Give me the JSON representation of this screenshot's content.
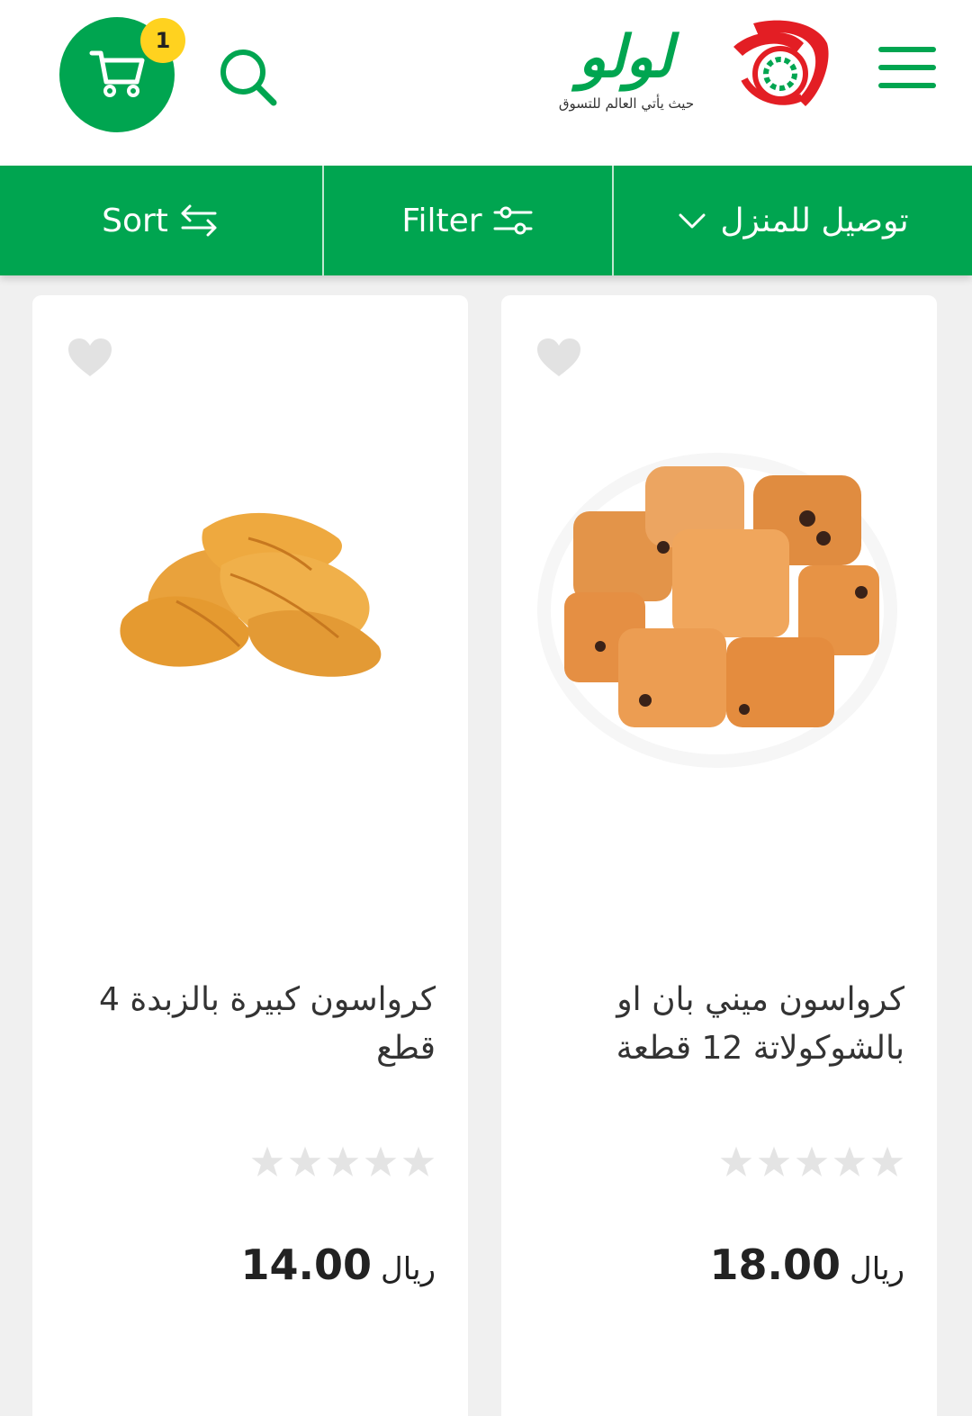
{
  "header": {
    "logo_text": "لولو",
    "logo_tagline": "حيث يأتي العالم للتسوق",
    "cart_count": "1",
    "brand_color": "#00a550",
    "badge_color": "#ffd21f",
    "icons": {
      "menu": "hamburger-menu-icon",
      "search": "search-icon",
      "cart": "shopping-cart-icon"
    }
  },
  "toolbar": {
    "sort_label": "Sort",
    "filter_label": "Filter",
    "delivery_label": "توصيل للمنزل",
    "icons": {
      "sort": "swap-arrows-icon",
      "filter": "sliders-icon",
      "delivery": "chevron-down-icon"
    }
  },
  "products": [
    {
      "name": "كرواسون ميني بان او بالشوكولاتة 12 قطعة",
      "currency": "ريال",
      "price": "18.00",
      "rating": 0,
      "image": "pain-au-chocolat-pile"
    },
    {
      "name": "كرواسون كبيرة بالزبدة 4 قطع",
      "currency": "ريال",
      "price": "14.00",
      "rating": 0,
      "image": "butter-croissants"
    }
  ]
}
